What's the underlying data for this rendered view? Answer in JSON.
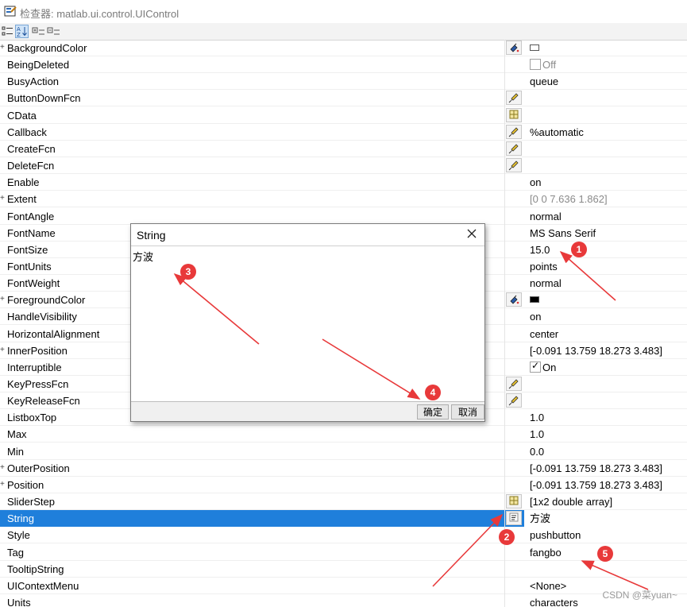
{
  "window": {
    "title": "检查器: matlab.ui.control.UIControl"
  },
  "properties": [
    {
      "name": "BackgroundColor",
      "expand": true,
      "button": "color",
      "value": "",
      "kind": "swatch-white"
    },
    {
      "name": "BeingDeleted",
      "value": "Off",
      "kind": "checkbox-off"
    },
    {
      "name": "BusyAction",
      "value": "queue"
    },
    {
      "name": "ButtonDownFcn",
      "button": "edit",
      "value": ""
    },
    {
      "name": "CData",
      "button": "grid",
      "value": ""
    },
    {
      "name": "Callback",
      "button": "edit",
      "value": "%automatic"
    },
    {
      "name": "CreateFcn",
      "button": "edit",
      "value": ""
    },
    {
      "name": "DeleteFcn",
      "button": "edit",
      "value": ""
    },
    {
      "name": "Enable",
      "value": "on"
    },
    {
      "name": "Extent",
      "expand": true,
      "value": "[0 0 7.636 1.862]",
      "kind": "muted"
    },
    {
      "name": "FontAngle",
      "value": "normal"
    },
    {
      "name": "FontName",
      "value": "MS Sans Serif"
    },
    {
      "name": "FontSize",
      "value": "15.0"
    },
    {
      "name": "FontUnits",
      "value": "points"
    },
    {
      "name": "FontWeight",
      "value": "normal"
    },
    {
      "name": "ForegroundColor",
      "expand": true,
      "button": "color",
      "value": "",
      "kind": "swatch-black"
    },
    {
      "name": "HandleVisibility",
      "value": "on"
    },
    {
      "name": "HorizontalAlignment",
      "value": "center"
    },
    {
      "name": "InnerPosition",
      "expand": true,
      "value": "[-0.091 13.759 18.273 3.483]"
    },
    {
      "name": "Interruptible",
      "value": "On",
      "kind": "checkbox-on"
    },
    {
      "name": "KeyPressFcn",
      "button": "edit",
      "value": ""
    },
    {
      "name": "KeyReleaseFcn",
      "button": "edit",
      "value": ""
    },
    {
      "name": "ListboxTop",
      "value": "1.0"
    },
    {
      "name": "Max",
      "value": "1.0"
    },
    {
      "name": "Min",
      "value": "0.0"
    },
    {
      "name": "OuterPosition",
      "expand": true,
      "value": "[-0.091 13.759 18.273 3.483]"
    },
    {
      "name": "Position",
      "expand": true,
      "value": "[-0.091 13.759 18.273 3.483]"
    },
    {
      "name": "SliderStep",
      "button": "grid",
      "value": "[1x2  double array]"
    },
    {
      "name": "String",
      "button": "list",
      "value": "方波",
      "selected": true
    },
    {
      "name": "Style",
      "value": "pushbutton"
    },
    {
      "name": "Tag",
      "value": "fangbo"
    },
    {
      "name": "TooltipString",
      "value": ""
    },
    {
      "name": "UIContextMenu",
      "value": "<None>"
    },
    {
      "name": "Units",
      "value": "characters"
    }
  ],
  "dialog": {
    "title": "String",
    "text": "方波",
    "ok_label": "确定",
    "cancel_label": "取消"
  },
  "annotations": {
    "badges": [
      "1",
      "2",
      "3",
      "4",
      "5"
    ],
    "color": "#e8393a"
  },
  "watermark": "CSDN @菜yuan~",
  "colors": {
    "selection": "#1f7fdb"
  }
}
